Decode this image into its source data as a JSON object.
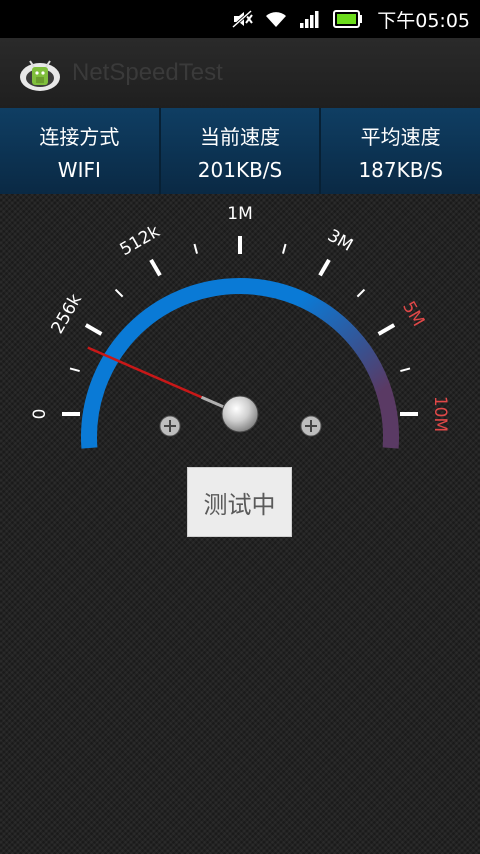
{
  "status_bar": {
    "time": "下午05:05",
    "icons": [
      "mute-icon",
      "wifi-icon",
      "signal-icon",
      "battery-icon"
    ]
  },
  "action_bar": {
    "app_title": "NetSpeedTest",
    "app_icon": "android-robot-icon"
  },
  "info_panel": [
    {
      "label": "连接方式",
      "value": "WIFI"
    },
    {
      "label": "当前速度",
      "value": "201KB/S"
    },
    {
      "label": "平均速度",
      "value": "187KB/S"
    }
  ],
  "gauge": {
    "labels": [
      "0",
      "256k",
      "512k",
      "1M",
      "3M",
      "5M",
      "10M"
    ],
    "needle_speed_kb": 201,
    "colors": {
      "arc_start": "#0a7ad6",
      "arc_end": "#5a3a64",
      "needle": "#c81818",
      "warn_label": "#e04848"
    }
  },
  "test_button": {
    "label": "测试中"
  }
}
